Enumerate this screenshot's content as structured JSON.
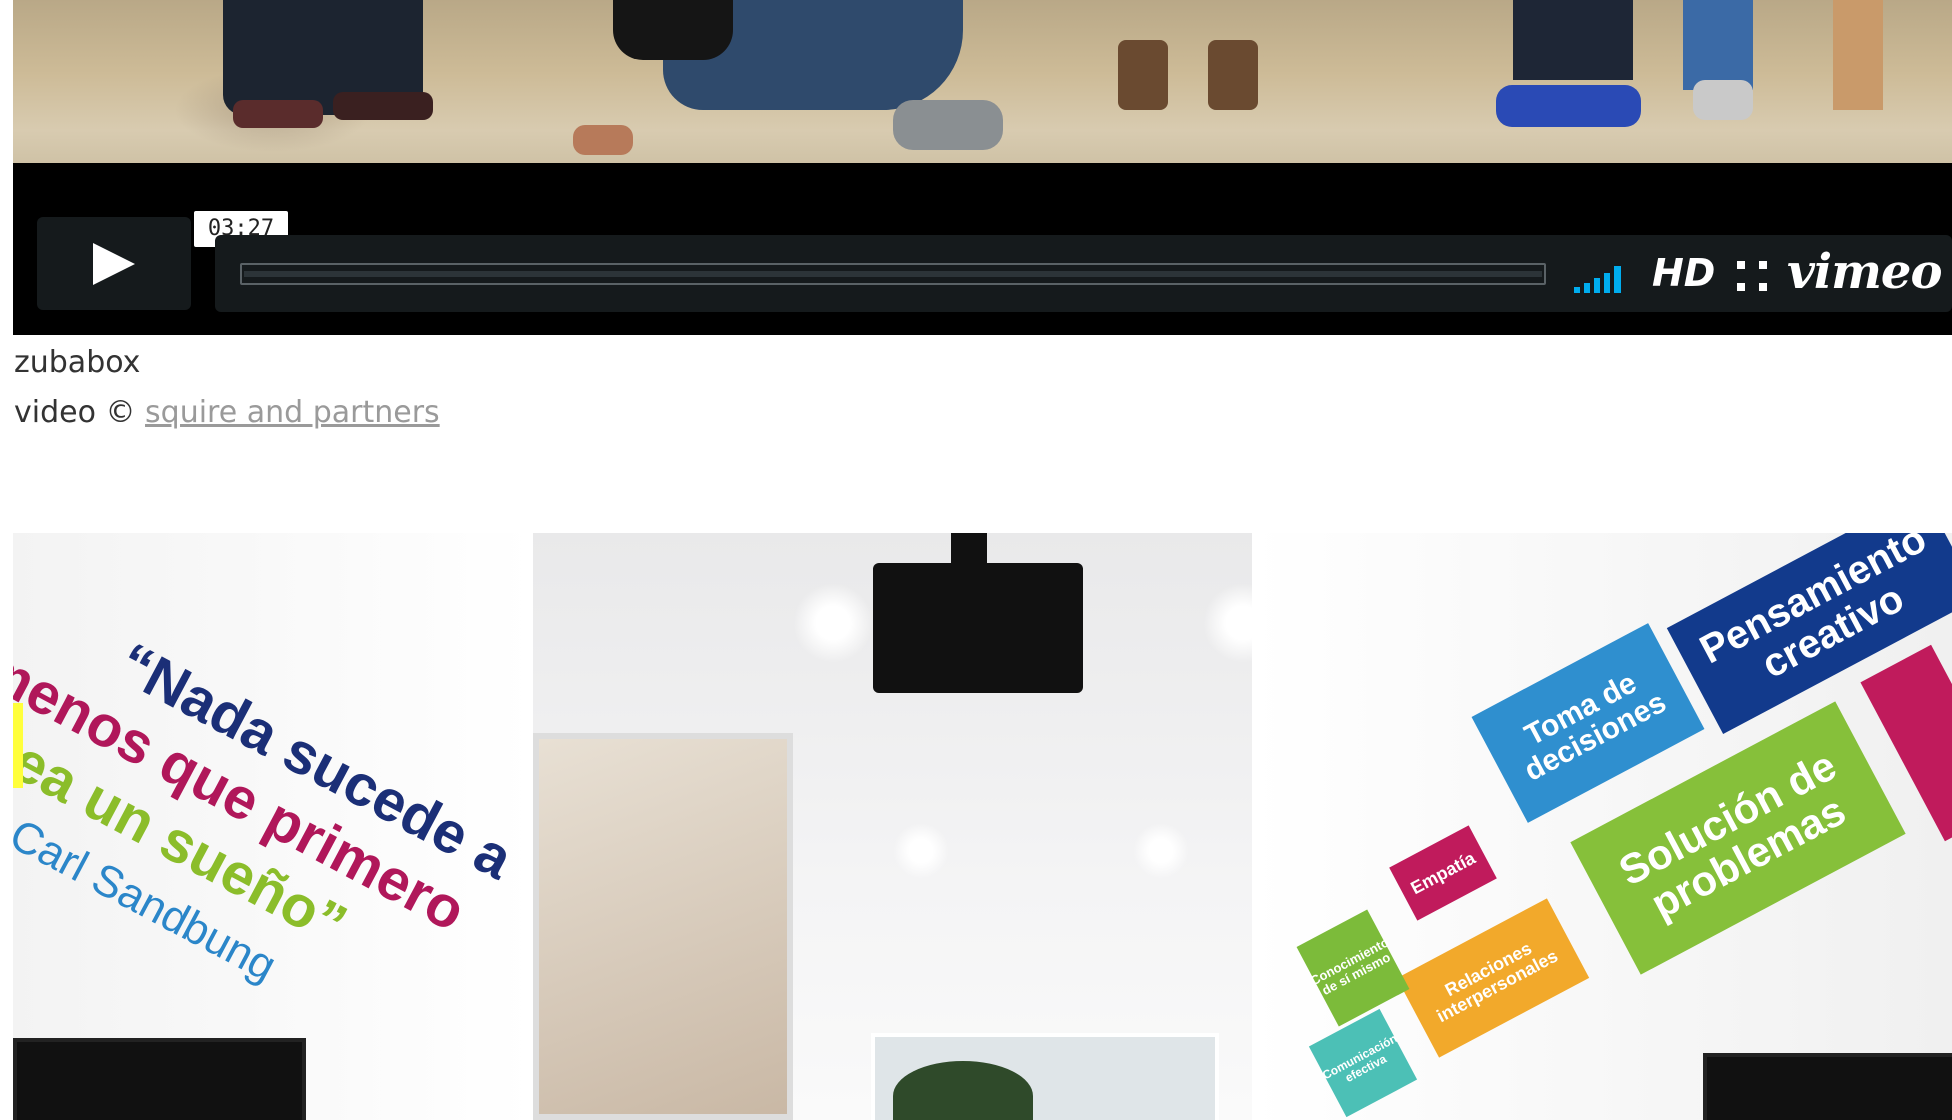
{
  "player": {
    "time": "03:27",
    "hd_label": "HD",
    "logo": "vimeo",
    "icons": {
      "play": "play-icon",
      "volume": "volume-icon",
      "fullscreen": "fullscreen-icon"
    },
    "colors": {
      "bar_background": "#000000",
      "control_background": "#151a1c",
      "volume_accent": "#00adef"
    }
  },
  "caption": {
    "title": "zubabox",
    "credit_prefix": "video ©",
    "credit_link": "squire and partners"
  },
  "room_photo": {
    "quote_line1": "“Nada sucede a",
    "quote_line2": "menos que primero",
    "quote_line3": "sea un sueño”",
    "quote_author": "—Carl Sandbung",
    "signs": {
      "toma_de_decisiones": "Toma de decisiones",
      "solucion_de_problemas": "Solución de problemas",
      "pensamiento_creativo": "Pensamiento creativo",
      "empatia": "Empatía",
      "relaciones_interpersonales": "Relaciones interpersonales",
      "conocimiento_de_si_mismo": "Conocimiento de sí mismo",
      "comunicacion_efectiva": "Comunicación efectiva"
    }
  }
}
